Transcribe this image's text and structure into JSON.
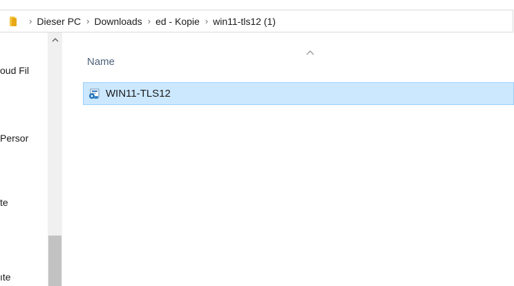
{
  "breadcrumb": {
    "items": [
      "Dieser PC",
      "Downloads",
      "ed - Kopie",
      "win11-tls12 (1)"
    ],
    "separator": "›"
  },
  "nav": {
    "items": [
      "oud Fil",
      "Persor",
      "te",
      "ıte"
    ]
  },
  "file_list": {
    "column_header": "Name",
    "files": [
      {
        "name": "WIN11-TLS12",
        "icon": "setup-installer-icon",
        "selected": true
      }
    ]
  },
  "colors": {
    "selection_bg": "#cce8ff",
    "selection_border": "#99d1ff",
    "header_text": "#4c607a",
    "folder": "#f4c542"
  }
}
